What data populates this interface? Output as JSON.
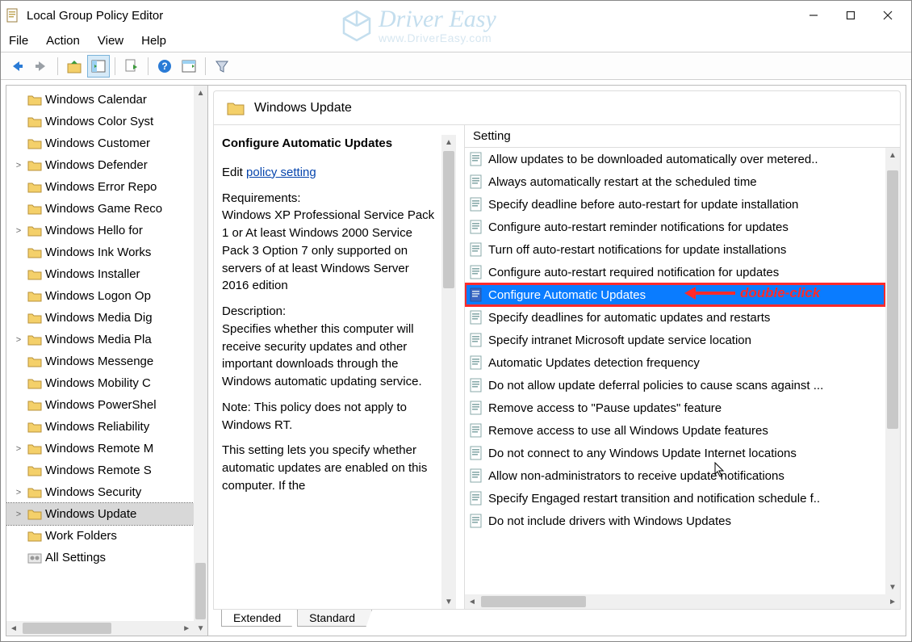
{
  "titlebar": {
    "title": "Local Group Policy Editor"
  },
  "menubar": {
    "items": [
      "File",
      "Action",
      "View",
      "Help"
    ]
  },
  "watermark": {
    "brand": "Driver Easy",
    "sub": "www.DriverEasy.com"
  },
  "tree": {
    "items": [
      {
        "label": "Windows Calendar",
        "expander": ""
      },
      {
        "label": "Windows Color Syst",
        "expander": ""
      },
      {
        "label": "Windows Customer",
        "expander": ""
      },
      {
        "label": "Windows Defender",
        "expander": ">"
      },
      {
        "label": "Windows Error Repo",
        "expander": ""
      },
      {
        "label": "Windows Game Reco",
        "expander": ""
      },
      {
        "label": "Windows Hello for",
        "expander": ">"
      },
      {
        "label": "Windows Ink Works",
        "expander": ""
      },
      {
        "label": "Windows Installer",
        "expander": ""
      },
      {
        "label": "Windows Logon Op",
        "expander": ""
      },
      {
        "label": "Windows Media Dig",
        "expander": ""
      },
      {
        "label": "Windows Media Pla",
        "expander": ">"
      },
      {
        "label": "Windows Messenge",
        "expander": ""
      },
      {
        "label": "Windows Mobility C",
        "expander": ""
      },
      {
        "label": "Windows PowerShel",
        "expander": ""
      },
      {
        "label": "Windows Reliability",
        "expander": ""
      },
      {
        "label": "Windows Remote M",
        "expander": ">"
      },
      {
        "label": "Windows Remote S",
        "expander": ""
      },
      {
        "label": "Windows Security",
        "expander": ">"
      },
      {
        "label": "Windows Update",
        "expander": ">",
        "selected": true
      },
      {
        "label": "Work Folders",
        "expander": ""
      },
      {
        "label": "All Settings",
        "expander": "",
        "icon": "gear"
      }
    ]
  },
  "rightPane": {
    "headerTitle": "Windows Update",
    "infoTitle": "Configure Automatic Updates",
    "editLabel": "Edit",
    "policyLink": "policy setting",
    "requirementsLabel": "Requirements:",
    "requirementsText": "Windows XP Professional Service Pack 1 or At least Windows 2000 Service Pack 3 Option 7 only supported on servers of at least Windows Server 2016 edition",
    "descriptionLabel": "Description:",
    "descriptionText1": "Specifies whether this computer will receive security updates and other important downloads through the Windows automatic updating service.",
    "descriptionText2": "Note: This policy does not apply to Windows RT.",
    "descriptionText3": "This setting lets you specify whether automatic updates are enabled on this computer. If the",
    "listHeader": "Setting",
    "settings": [
      "Allow updates to be downloaded automatically over metered..",
      "Always automatically restart at the scheduled time",
      "Specify deadline before auto-restart for update installation",
      "Configure auto-restart reminder notifications for updates",
      "Turn off auto-restart notifications for update installations",
      "Configure auto-restart required notification for updates",
      "Configure Automatic Updates",
      "Specify deadlines for automatic updates and restarts",
      "Specify intranet Microsoft update service location",
      "Automatic Updates detection frequency",
      "Do not allow update deferral policies to cause scans against ...",
      "Remove access to \"Pause updates\" feature",
      "Remove access to use all Windows Update features",
      "Do not connect to any Windows Update Internet locations",
      "Allow non-administrators to receive update notifications",
      "Specify Engaged restart transition and notification schedule f..",
      "Do not include drivers with Windows Updates"
    ],
    "selectedIndex": 6,
    "annotation": "double-click"
  },
  "tabs": {
    "items": [
      "Extended",
      "Standard"
    ],
    "activeIndex": 0
  }
}
